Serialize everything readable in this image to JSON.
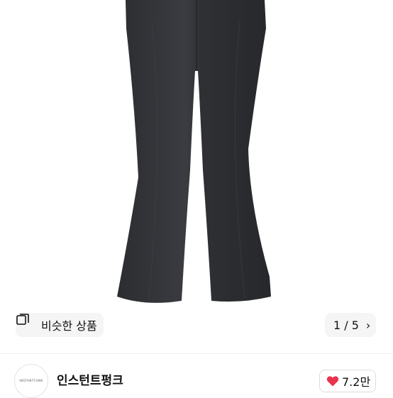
{
  "product_image": {
    "description_icon": "flared-black-pants-photo"
  },
  "similar_button": {
    "icon": "similar-items-icon",
    "label": "비슷한 상품"
  },
  "pager": {
    "label": "1 / 5",
    "chevron": "›"
  },
  "seller": {
    "avatar_logo": "INSTANTFUNK",
    "name": "인스턴트펑크"
  },
  "like": {
    "icon": "heart-icon",
    "count": "7.2만",
    "color": "#e8344e"
  }
}
